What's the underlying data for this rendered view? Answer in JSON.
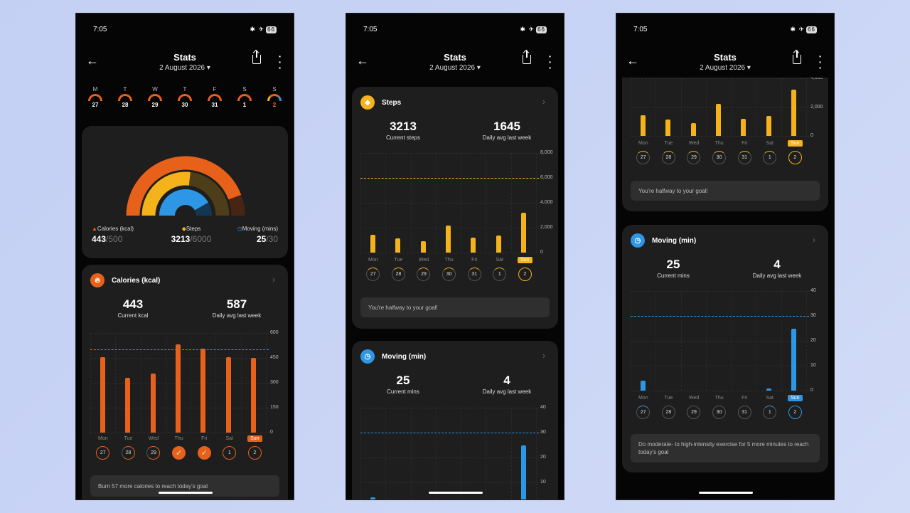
{
  "status": {
    "time": "7:05",
    "icons": "✱ ✈",
    "battery": "66"
  },
  "header": {
    "title": "Stats",
    "date": "2 August 2026 ▾"
  },
  "icons": {
    "back": "back-arrow-icon",
    "share": "share-icon",
    "more": "more-vert-icon",
    "flame": "flame-icon",
    "shoe": "shoe-icon",
    "clock": "clock-icon"
  },
  "colors": {
    "calories": "#e8611a",
    "steps": "#f4b21b",
    "moving": "#2d96e5"
  },
  "week": [
    {
      "d": "M",
      "n": "27"
    },
    {
      "d": "T",
      "n": "28"
    },
    {
      "d": "W",
      "n": "29"
    },
    {
      "d": "T",
      "n": "30"
    },
    {
      "d": "F",
      "n": "31"
    },
    {
      "d": "S",
      "n": "1"
    },
    {
      "d": "S",
      "n": "2"
    }
  ],
  "summary": {
    "calories": {
      "label": "Calories (kcal)",
      "value": "443",
      "goal": "/500",
      "progress": 0.886
    },
    "steps": {
      "label": "Steps",
      "value": "3213",
      "goal": "/6000",
      "progress": 0.5355
    },
    "moving": {
      "label": "Moving (mins)",
      "value": "25",
      "goal": "/30",
      "progress": 0.833
    }
  },
  "days": [
    "Mon",
    "Tue",
    "Wed",
    "Thu",
    "Fri",
    "Sat",
    "Sun"
  ],
  "dates": [
    "27",
    "28",
    "29",
    "30",
    "31",
    "1",
    "2"
  ],
  "check": "✓",
  "calories_card": {
    "title": "Calories (kcal)",
    "current": "443",
    "current_label": "Current kcal",
    "avg": "587",
    "avg_label": "Daily avg last week",
    "message": "Burn 57 more calories to reach today's goal"
  },
  "steps_card": {
    "title": "Steps",
    "current": "3213",
    "current_label": "Current steps",
    "avg": "1645",
    "avg_label": "Daily avg last week",
    "message": "You're halfway to your goal!"
  },
  "moving_card": {
    "title": "Moving (min)",
    "current": "25",
    "current_label": "Current mins",
    "avg": "4",
    "avg_label": "Daily avg last week",
    "message": "Do moderate- to high-intensity exercise for 5 more minutes to reach today's goal"
  },
  "chart_data": [
    {
      "type": "bar",
      "title": "Calories (kcal)",
      "categories": [
        "Mon",
        "Tue",
        "Wed",
        "Thu",
        "Fri",
        "Sat",
        "Sun"
      ],
      "values": [
        455,
        330,
        355,
        530,
        505,
        455,
        450
      ],
      "goal": 500,
      "ylim": [
        0,
        600
      ],
      "yticks": [
        "600",
        "450",
        "300",
        "150",
        "0"
      ]
    },
    {
      "type": "bar",
      "title": "Steps",
      "categories": [
        "Mon",
        "Tue",
        "Wed",
        "Thu",
        "Fri",
        "Sat",
        "Sun"
      ],
      "values": [
        1450,
        1150,
        900,
        2200,
        1200,
        1400,
        3213
      ],
      "goal": 6000,
      "ylim": [
        0,
        8000
      ],
      "yticks": [
        "8,000",
        "6,000",
        "4,000",
        "2,000",
        "0"
      ]
    },
    {
      "type": "bar",
      "title": "Moving (min)",
      "categories": [
        "Mon",
        "Tue",
        "Wed",
        "Thu",
        "Fri",
        "Sat",
        "Sun"
      ],
      "values": [
        4,
        0,
        0,
        0,
        0,
        1,
        25
      ],
      "goal": 30,
      "ylim": [
        0,
        40
      ],
      "yticks": [
        "40",
        "30",
        "20",
        "10",
        "0"
      ]
    }
  ]
}
